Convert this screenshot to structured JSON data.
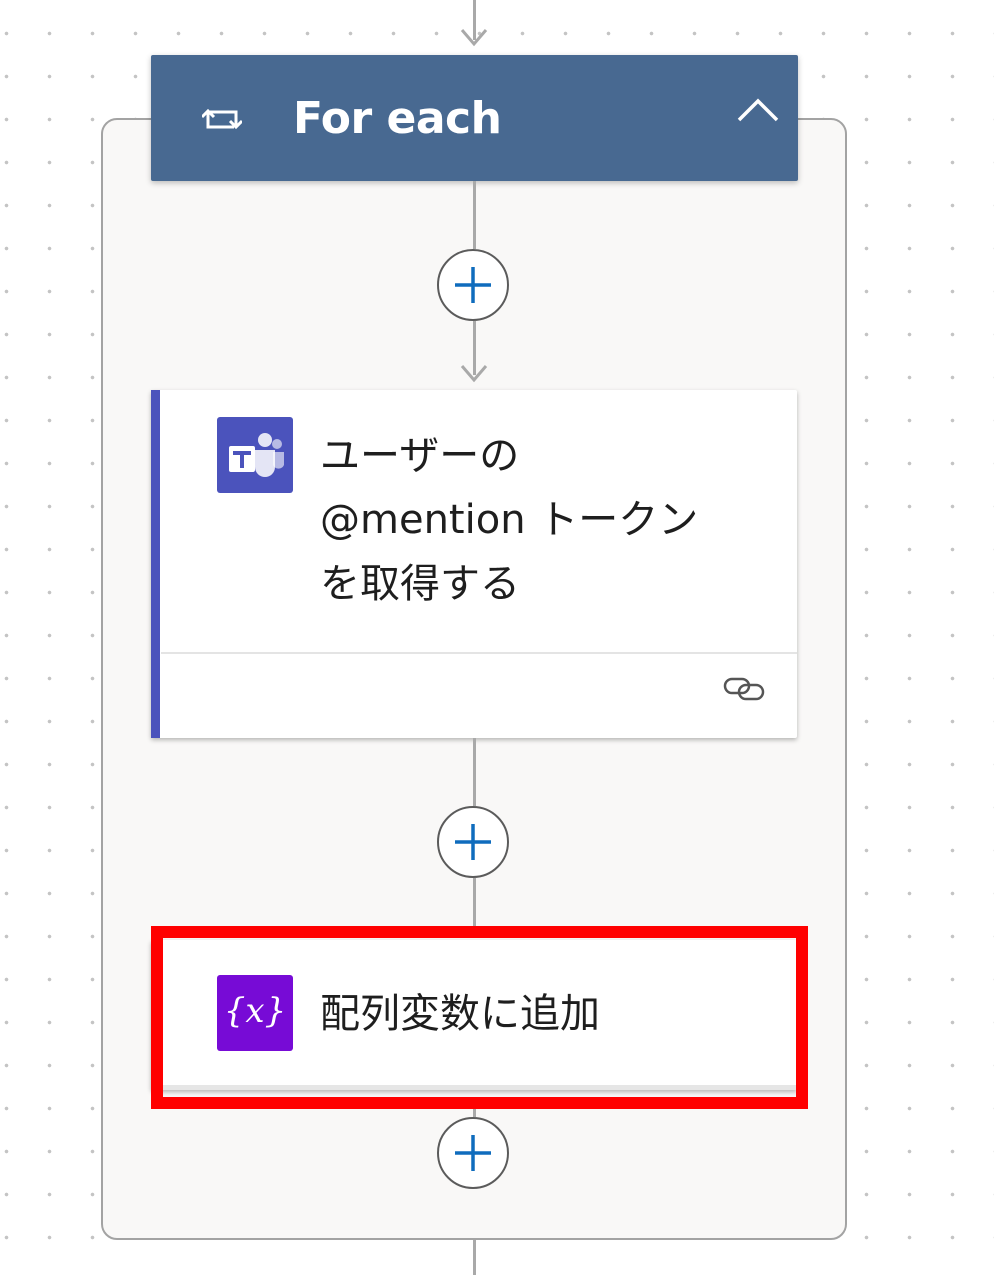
{
  "flow": {
    "foreach": {
      "title": "For each",
      "icon": "loop-icon",
      "collapse_icon": "chevron-up-icon",
      "header_color": "#486991"
    },
    "steps": [
      {
        "title_lines": [
          "ユーザーの",
          "@mention トークン",
          "を取得する"
        ],
        "icon": "teams-icon",
        "icon_color": "#4b53bc",
        "footer_icon": "link-icon"
      },
      {
        "title": "配列変数に追加",
        "icon": "variable-icon",
        "icon_glyph": "{x}",
        "icon_color": "#770bd6",
        "highlighted": true,
        "highlight_color": "#ff0000"
      }
    ],
    "add_step_icon": "plus-icon",
    "accent_color": "#0f6cbd"
  }
}
